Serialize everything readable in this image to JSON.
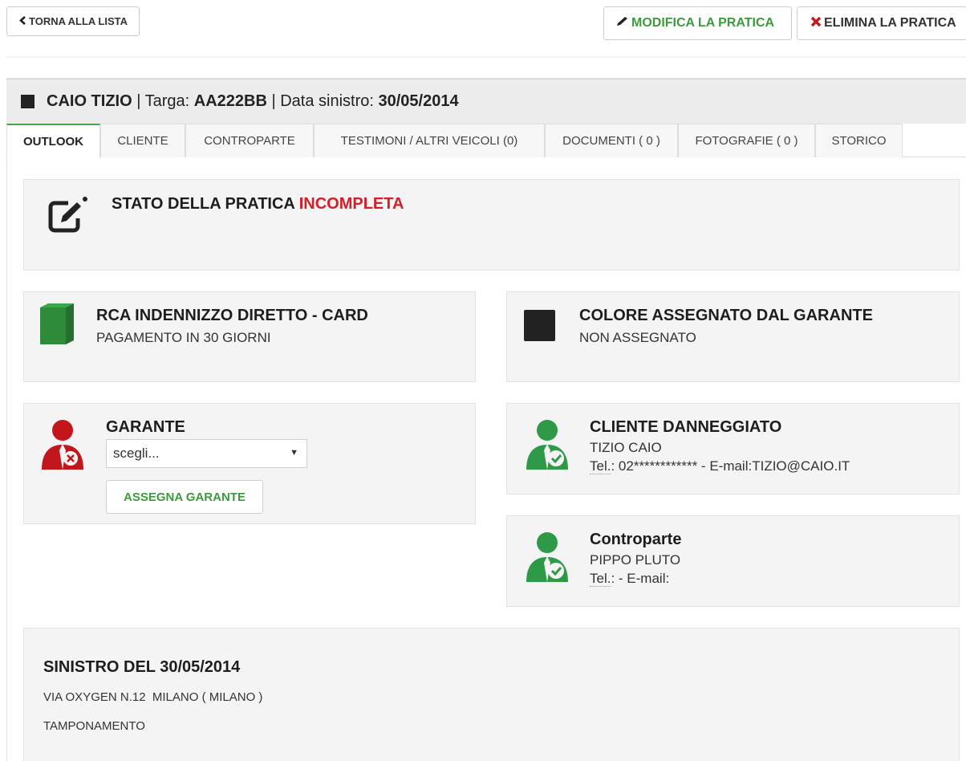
{
  "toolbar": {
    "back_label": "TORNA ALLA LISTA",
    "edit_label": "MODIFICA LA PRATICA",
    "delete_label": "ELIMINA LA PRATICA"
  },
  "header": {
    "client_name": "CAIO TIZIO",
    "sep1": " | Targa: ",
    "plate": "AA222BB",
    "sep2": " | Data sinistro: ",
    "date": "30/05/2014"
  },
  "tabs": [
    {
      "label": "OUTLOOK",
      "active": true
    },
    {
      "label": "CLIENTE"
    },
    {
      "label": "CONTROPARTE"
    },
    {
      "label": "TESTIMONI / ALTRI VEICOLI (0)"
    },
    {
      "label": "DOCUMENTI ( 0 )"
    },
    {
      "label": "FOTOGRAFIE ( 0 )"
    },
    {
      "label": "STORICO"
    }
  ],
  "status": {
    "prefix": "STATO DELLA PRATICA ",
    "value": "INCOMPLETA",
    "value_color": "#d0202a"
  },
  "rca": {
    "title": "RCA INDENNIZZO DIRETTO - CARD",
    "subtitle": "PAGAMENTO IN 30 GIORNI"
  },
  "colore": {
    "title": "COLORE ASSEGNATO DAL GARANTE",
    "value": "NON ASSEGNATO"
  },
  "garante": {
    "title": "GARANTE",
    "select_value": "scegli...",
    "assign_label": "ASSEGNA GARANTE"
  },
  "cliente": {
    "title": "CLIENTE DANNEGGIATO",
    "name": "TIZIO CAIO",
    "tel_label": "Tel.",
    "tel_rest": ": 02************ - E-mail:TIZIO@CAIO.IT"
  },
  "controparte": {
    "title": "Controparte",
    "name": "PIPPO PLUTO",
    "tel_label": "Tel.",
    "tel_rest": ": - E-mail:"
  },
  "sinistro": {
    "title": "SINISTRO DEL 30/05/2014",
    "address": "VIA OXYGEN N.12  MILANO ( MILANO )",
    "type": "TAMPONAMENTO"
  },
  "colors": {
    "accent_green": "#3f9a3f",
    "danger_red": "#c0181f",
    "user_ok_green": "#2e9a47",
    "user_error_red": "#c3161c"
  },
  "icons": {
    "back": "chevron-left-icon",
    "edit": "pencil-icon",
    "delete": "x-icon",
    "status": "edit-square-icon",
    "rca": "book-icon",
    "colore": "square-icon",
    "garante": "user-error-icon",
    "cliente": "user-check-icon",
    "controparte": "user-check-icon"
  }
}
